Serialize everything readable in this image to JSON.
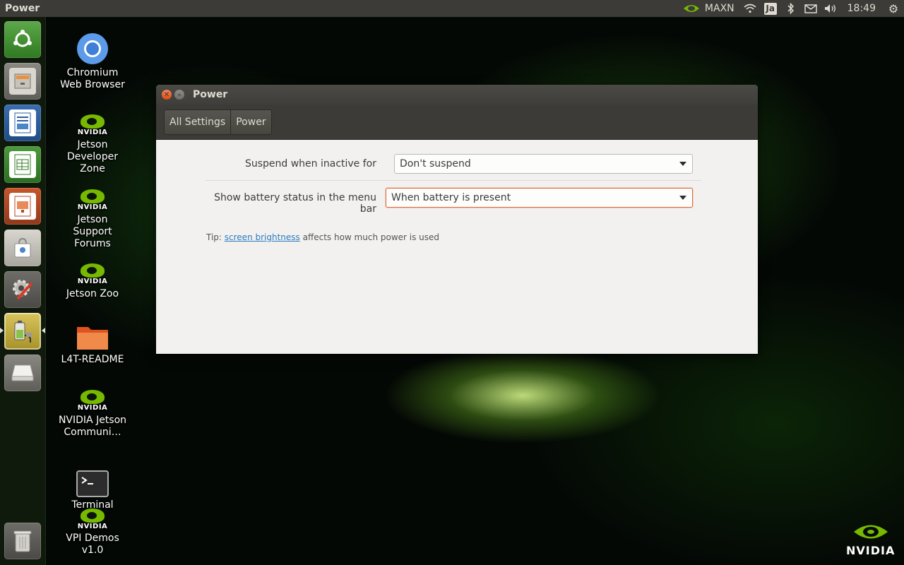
{
  "top_panel": {
    "app_title": "Power",
    "power_mode": "MAXN",
    "keyboard_layout": "Ja",
    "clock": "18:49"
  },
  "launcher": {
    "items": [
      {
        "name": "dash-home",
        "icon": "ubuntu-logo-icon"
      },
      {
        "name": "files",
        "icon": "file-cabinet-icon"
      },
      {
        "name": "libreoffice-writer",
        "icon": "writer-icon"
      },
      {
        "name": "libreoffice-calc",
        "icon": "calc-icon"
      },
      {
        "name": "libreoffice-impress",
        "icon": "impress-icon"
      },
      {
        "name": "software-center",
        "icon": "shopping-bag-icon"
      },
      {
        "name": "system-settings",
        "icon": "settings-wrench-icon"
      },
      {
        "name": "power",
        "icon": "battery-plug-icon",
        "active": true
      },
      {
        "name": "drive",
        "icon": "removable-drive-icon"
      },
      {
        "name": "trash",
        "icon": "trash-icon"
      }
    ]
  },
  "desktop": {
    "icons": [
      {
        "label": "Chromium Web Browser",
        "icon": "chromium-icon"
      },
      {
        "label": "Jetson Developer Zone",
        "icon": "nvidia-icon"
      },
      {
        "label": "Jetson Support Forums",
        "icon": "nvidia-icon"
      },
      {
        "label": "Jetson Zoo",
        "icon": "nvidia-icon"
      },
      {
        "label": "L4T-README",
        "icon": "folder-icon"
      },
      {
        "label": "NVIDIA Jetson Communi…",
        "icon": "nvidia-icon"
      },
      {
        "label": "Terminal",
        "icon": "terminal-icon"
      },
      {
        "label": "VPI Demos v1.0",
        "icon": "nvidia-icon"
      }
    ],
    "nvidia_logo_text": "NVIDIA",
    "nvidia_small_text": "NVIDIA"
  },
  "window": {
    "title": "Power",
    "breadcrumbs": [
      "All Settings",
      "Power"
    ],
    "settings": {
      "suspend_label": "Suspend when inactive for",
      "suspend_value": "Don't suspend",
      "battery_label": "Show battery status in the menu bar",
      "battery_value": "When battery is present"
    },
    "tip": {
      "prefix": "Tip: ",
      "link": "screen brightness",
      "suffix": " affects how much power is used"
    }
  },
  "colors": {
    "accent": "#e06b3a",
    "nvidia_green": "#76b900",
    "panel": "#3c3b37",
    "link": "#2c7cbf"
  }
}
